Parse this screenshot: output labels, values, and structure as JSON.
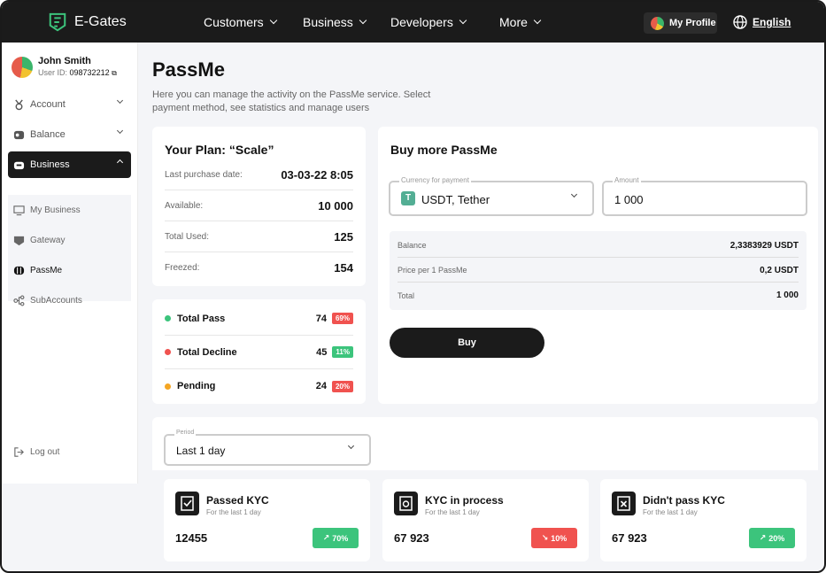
{
  "app": {
    "name": "E-Gates"
  },
  "nav": {
    "items": [
      "Customers",
      "Business",
      "Developers",
      "More"
    ],
    "profile": "My Profile",
    "language": "English"
  },
  "user": {
    "name": "John Smith",
    "id_label": "User ID:",
    "id": "098732212"
  },
  "sidebar": {
    "items": [
      {
        "label": "Account",
        "icon": "medal-icon"
      },
      {
        "label": "Balance",
        "icon": "wallet-icon"
      },
      {
        "label": "Business",
        "icon": "briefcase-icon"
      }
    ],
    "sub_items": [
      {
        "label": "My Business",
        "icon": "monitor-icon"
      },
      {
        "label": "Gateway",
        "icon": "gateway-icon"
      },
      {
        "label": "PassMe",
        "icon": "passme-icon"
      },
      {
        "label": "SubAccounts",
        "icon": "hierarchy-icon"
      }
    ],
    "logout": "Log out"
  },
  "page": {
    "title": "PassMe",
    "description": "Here you can manage the activity on the PassMe service. Select payment method, see statistics and manage users"
  },
  "plan": {
    "title": "Your Plan: “Scale”",
    "rows": [
      {
        "label": "Last purchase date:",
        "value": "03-03-22 8:05"
      },
      {
        "label": "Available:",
        "value": "10 000"
      },
      {
        "label": "Total Used:",
        "value": "125"
      },
      {
        "label": "Freezed:",
        "value": "154"
      }
    ]
  },
  "stats": [
    {
      "label": "Total Pass",
      "count": "74",
      "percent": "69%",
      "color": "#3cc47c",
      "badge_color": "#f0524f"
    },
    {
      "label": "Total Decline",
      "count": "45",
      "percent": "11%",
      "color": "#f0524f",
      "badge_color": "#3cc47c"
    },
    {
      "label": "Pending",
      "count": "24",
      "percent": "20%",
      "color": "#f5a623",
      "badge_color": "#f0524f"
    }
  ],
  "buy": {
    "title": "Buy more PassMe",
    "currency_label": "Currency for payment",
    "currency_value": "USDT, Tether",
    "currency_badge": "T",
    "amount_label": "Amount",
    "amount_value": "1 000",
    "summary": [
      {
        "label": "Balance",
        "value": "2,3383929 USDT"
      },
      {
        "label": "Price per 1 PassMe",
        "value": "0,2 USDT"
      },
      {
        "label": "Total",
        "value": "1 000"
      }
    ],
    "button": "Buy"
  },
  "period": {
    "label": "Period",
    "value": "Last 1 day"
  },
  "kyc": [
    {
      "title": "Passed KYC",
      "sub": "For the last 1 day",
      "value": "12455",
      "change": "70%",
      "trend": "up",
      "color": "#3cc47c"
    },
    {
      "title": "KYC in process",
      "sub": "For the last 1 day",
      "value": "67 923",
      "change": "10%",
      "trend": "down",
      "color": "#f0524f"
    },
    {
      "title": "Didn't pass KYC",
      "sub": "For the last 1 day",
      "value": "67 923",
      "change": "20%",
      "trend": "up",
      "color": "#3cc47c"
    }
  ]
}
